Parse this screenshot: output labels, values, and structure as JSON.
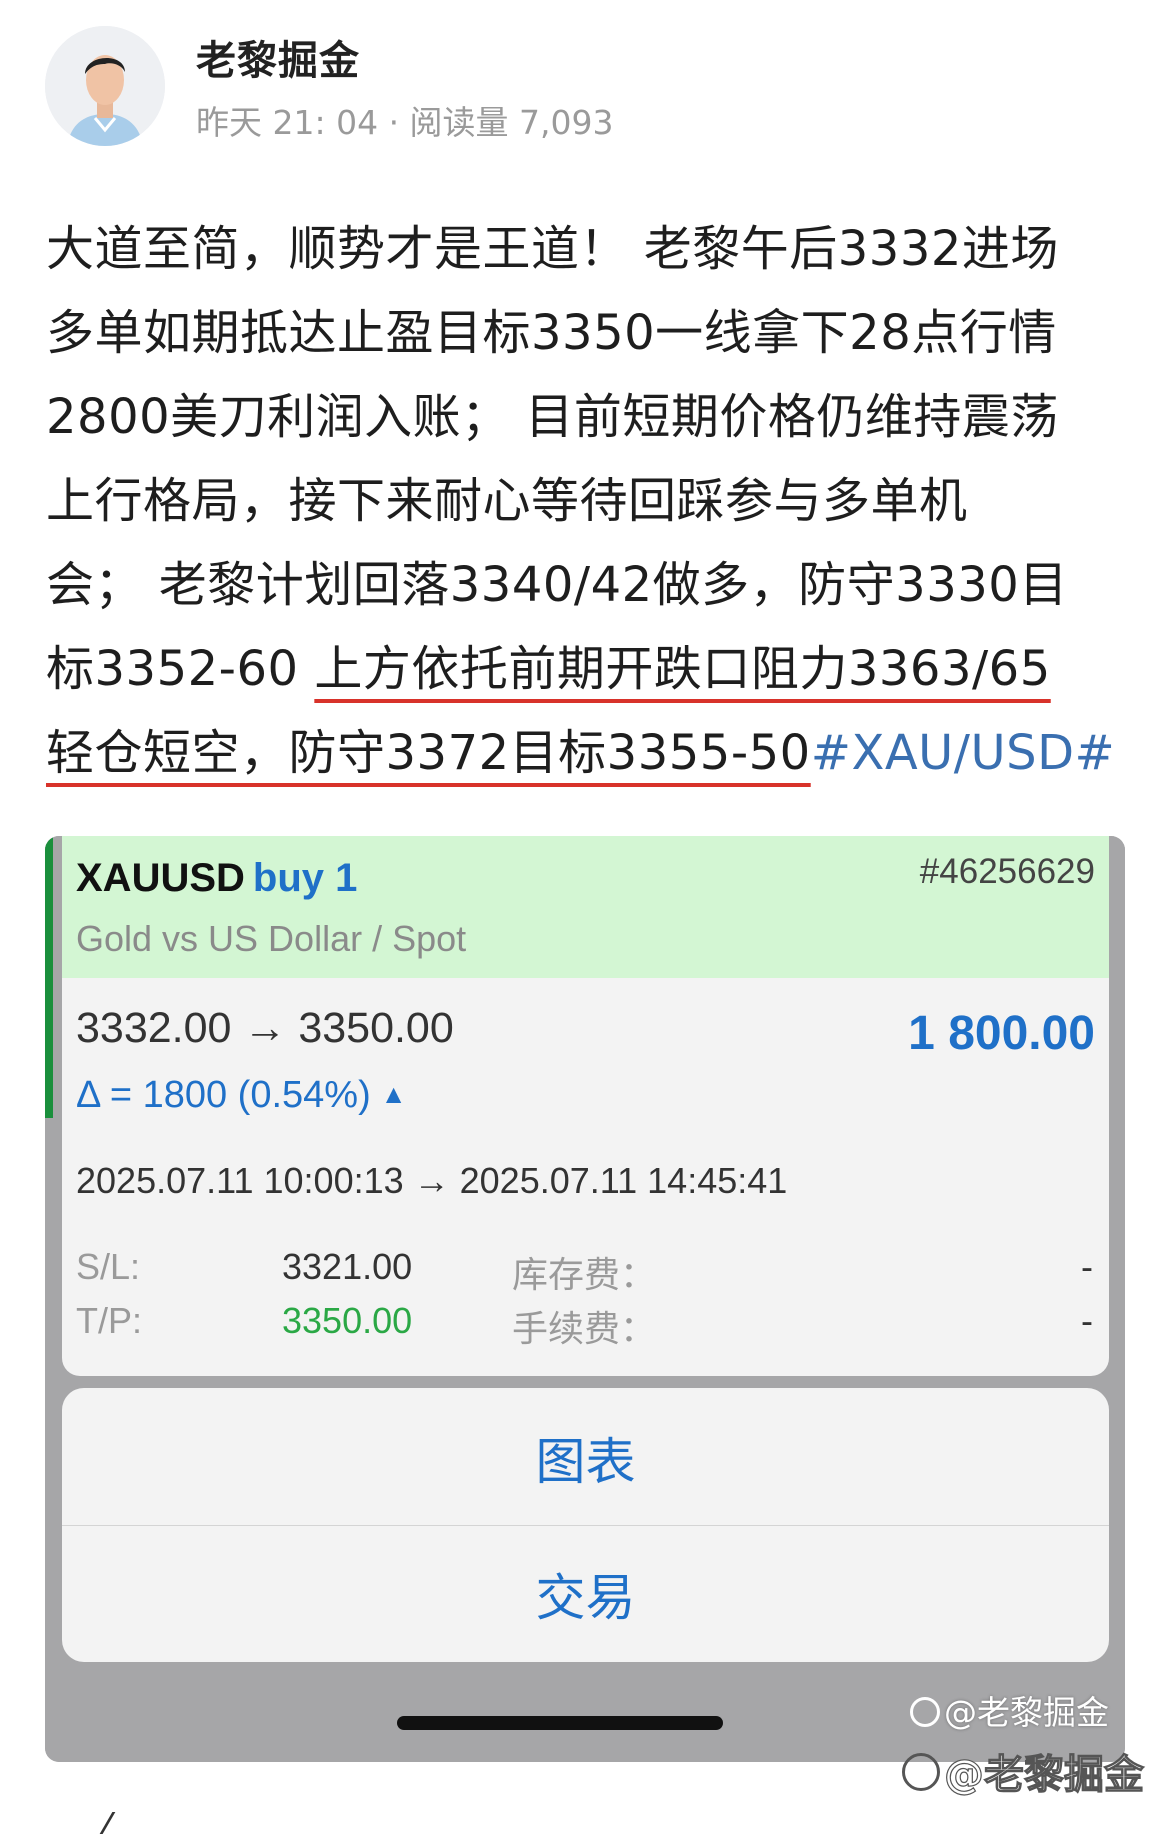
{
  "author": {
    "name": "老黎掘金",
    "meta": "昨天 21: 04 · 阅读量 7,093"
  },
  "post": {
    "lines": [
      "大道至简，顺势才是王道！ 老黎午后3332进场",
      "多单如期抵达止盈目标3350一线拿下28点行情",
      "2800美刀利润入账； 目前短期价格仍维持震荡",
      "上行格局，接下来耐心等待回踩参与多单机",
      "会； 老黎计划回落3340/42做多，防守3330目"
    ],
    "line6_plain": "标3352-60 ",
    "line6_underlined": "上方依托前期开跌口阻力3363/65",
    "line7_underlined": "轻仓短空，防守3372目标3355-50",
    "hashtag": "#XAU/USD#"
  },
  "trade": {
    "symbol": "XAUUSD",
    "direction": "buy 1",
    "ticket": "#46256629",
    "description": "Gold vs US Dollar / Spot",
    "prices": "3332.00 → 3350.00",
    "profit": "1 800.00",
    "delta": "Δ = 1800 (0.54%)",
    "times": "2025.07.11 10:00:13 → 2025.07.11 14:45:41",
    "sl_label": "S/L:",
    "sl_value": "3321.00",
    "tp_label": "T/P:",
    "tp_value": "3350.00",
    "swap_label": "库存费：",
    "swap_value": "-",
    "commission_label": "手续费：",
    "commission_value": "-"
  },
  "actions": {
    "chart": "图表",
    "trade": "交易"
  },
  "watermark": {
    "small": "@老黎掘金",
    "large": "@老黎掘金"
  },
  "colors": {
    "accent_blue": "#1f70c8",
    "head_green": "#d3f6d3",
    "tp_green": "#2aa845",
    "underline_red": "#d8322a",
    "hashtag_blue": "#3a6fb0"
  }
}
